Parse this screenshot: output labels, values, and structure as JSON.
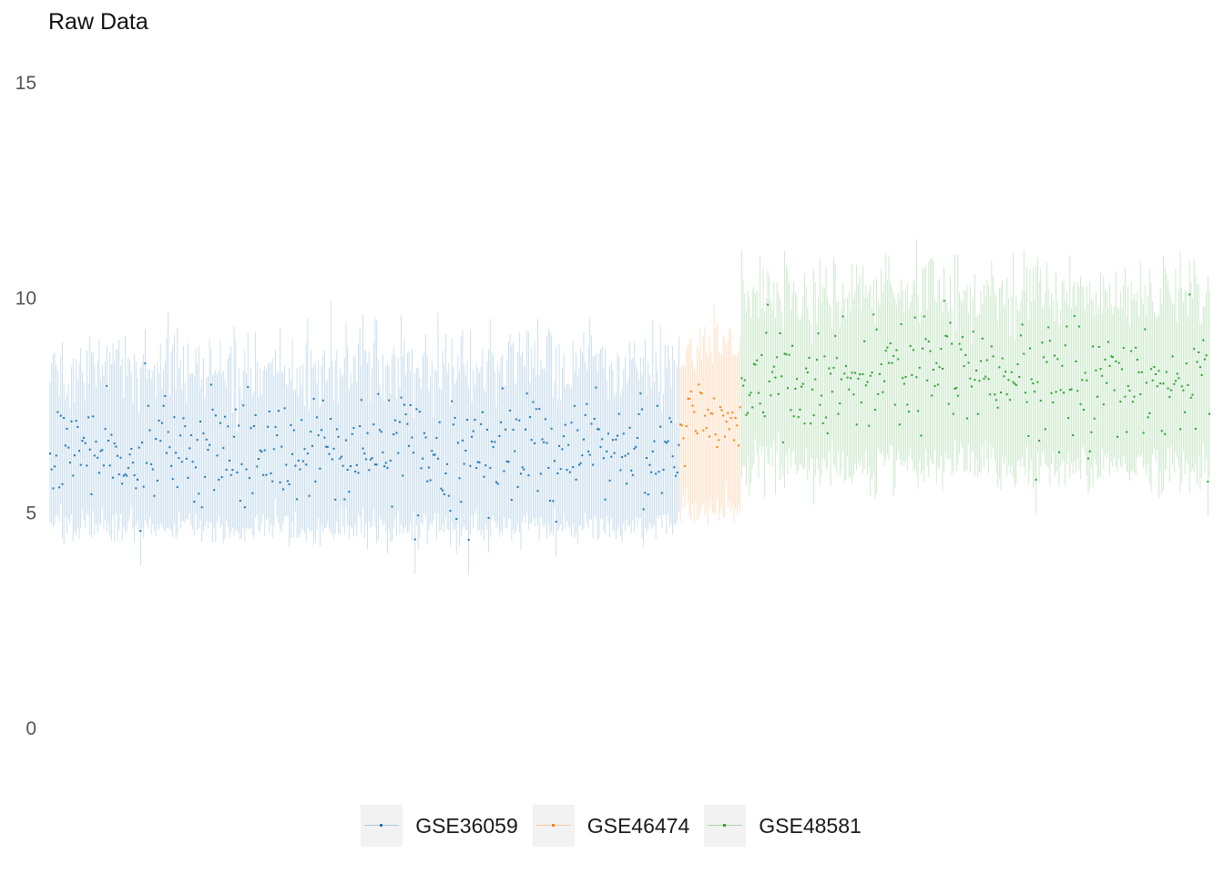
{
  "chart_data": {
    "type": "scatter",
    "title": "Raw Data",
    "xlabel": "",
    "ylabel": "",
    "ylim": [
      -1.2,
      15.5
    ],
    "yticks": [
      0,
      5,
      10,
      15
    ],
    "grid": false,
    "legend_position": "bottom",
    "description_of_marks": "each sample shown as a point (median) with a vertical range line",
    "series": [
      {
        "name": "GSE36059",
        "color": "#1f77b4",
        "n_samples": 411,
        "median_mean": 6.5,
        "median_sd": 0.62,
        "low_mean": 4.7,
        "low_sd": 0.22,
        "high_mean": 8.4,
        "high_sd": 0.55
      },
      {
        "name": "GSE46474",
        "color": "#ff7f0e",
        "n_samples": 40,
        "median_mean": 7.0,
        "median_sd": 0.42,
        "low_mean": 5.1,
        "low_sd": 0.25,
        "high_mean": 8.8,
        "high_sd": 0.35
      },
      {
        "name": "GSE48581",
        "color": "#2ca02c",
        "n_samples": 306,
        "median_mean": 8.1,
        "median_sd": 0.7,
        "low_mean": 6.1,
        "low_sd": 0.3,
        "high_mean": 10.1,
        "high_sd": 0.45
      }
    ]
  }
}
